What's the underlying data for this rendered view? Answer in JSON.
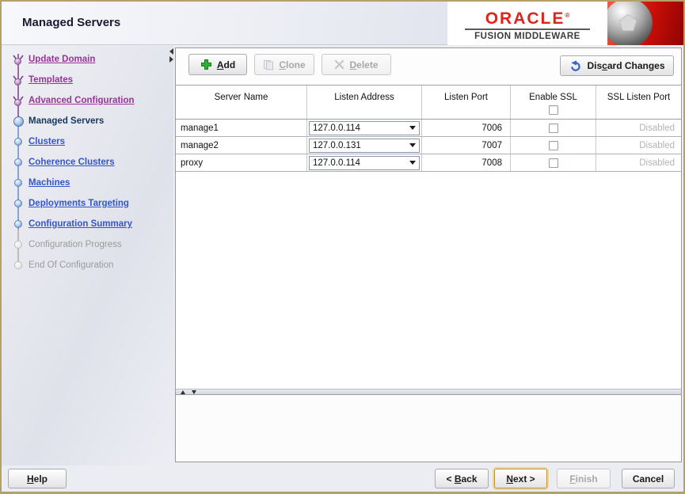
{
  "window": {
    "title": "Managed Servers"
  },
  "brand": {
    "wordmark": "ORACLE",
    "registered": "®",
    "subtitle": "FUSION MIDDLEWARE"
  },
  "colors": {
    "oracle_red": "#e2231a",
    "visited_link_purple": "#993399",
    "future_link_blue": "#3355cc",
    "current_step_navy": "#16365c",
    "disabled_gray": "#9b9b9b",
    "default_button_gold": "#bf9537",
    "add_icon_green": "#33b033"
  },
  "sidebar": {
    "items": [
      {
        "label": "Update Domain",
        "state": "visited"
      },
      {
        "label": "Templates",
        "state": "visited"
      },
      {
        "label": "Advanced Configuration",
        "state": "visited"
      },
      {
        "label": "Managed Servers",
        "state": "current"
      },
      {
        "label": "Clusters",
        "state": "future"
      },
      {
        "label": "Coherence Clusters",
        "state": "future"
      },
      {
        "label": "Machines",
        "state": "future"
      },
      {
        "label": "Deployments Targeting",
        "state": "future"
      },
      {
        "label": "Configuration Summary",
        "state": "future"
      },
      {
        "label": "Configuration Progress",
        "state": "disabled"
      },
      {
        "label": "End Of Configuration",
        "state": "disabled"
      }
    ]
  },
  "toolbar": {
    "add": {
      "mn": "A",
      "post": "dd"
    },
    "clone": {
      "mn": "C",
      "post": "lone"
    },
    "delete": {
      "mn": "D",
      "post": "elete"
    },
    "discard": {
      "pre": "Dis",
      "mn": "c",
      "post": "ard Changes"
    }
  },
  "table": {
    "columns": [
      "Server Name",
      "Listen Address",
      "Listen Port",
      "Enable SSL",
      "SSL Listen Port"
    ],
    "header_enable_ssl_checked": false,
    "rows": [
      {
        "server_name": "manage1",
        "listen_address": "127.0.0.114",
        "listen_port": "7006",
        "enable_ssl": false,
        "ssl_listen_port": "Disabled"
      },
      {
        "server_name": "manage2",
        "listen_address": "127.0.0.131",
        "listen_port": "7007",
        "enable_ssl": false,
        "ssl_listen_port": "Disabled"
      },
      {
        "server_name": "proxy",
        "listen_address": "127.0.0.114",
        "listen_port": "7008",
        "enable_ssl": false,
        "ssl_listen_port": "Disabled"
      }
    ]
  },
  "footer": {
    "help": {
      "mn": "H",
      "post": "elp"
    },
    "back": {
      "pre": "< ",
      "mn": "B",
      "post": "ack"
    },
    "next": {
      "mn": "N",
      "post": "ext >"
    },
    "finish": {
      "mn": "F",
      "post": "inish"
    },
    "cancel": {
      "label": "Cancel"
    }
  }
}
